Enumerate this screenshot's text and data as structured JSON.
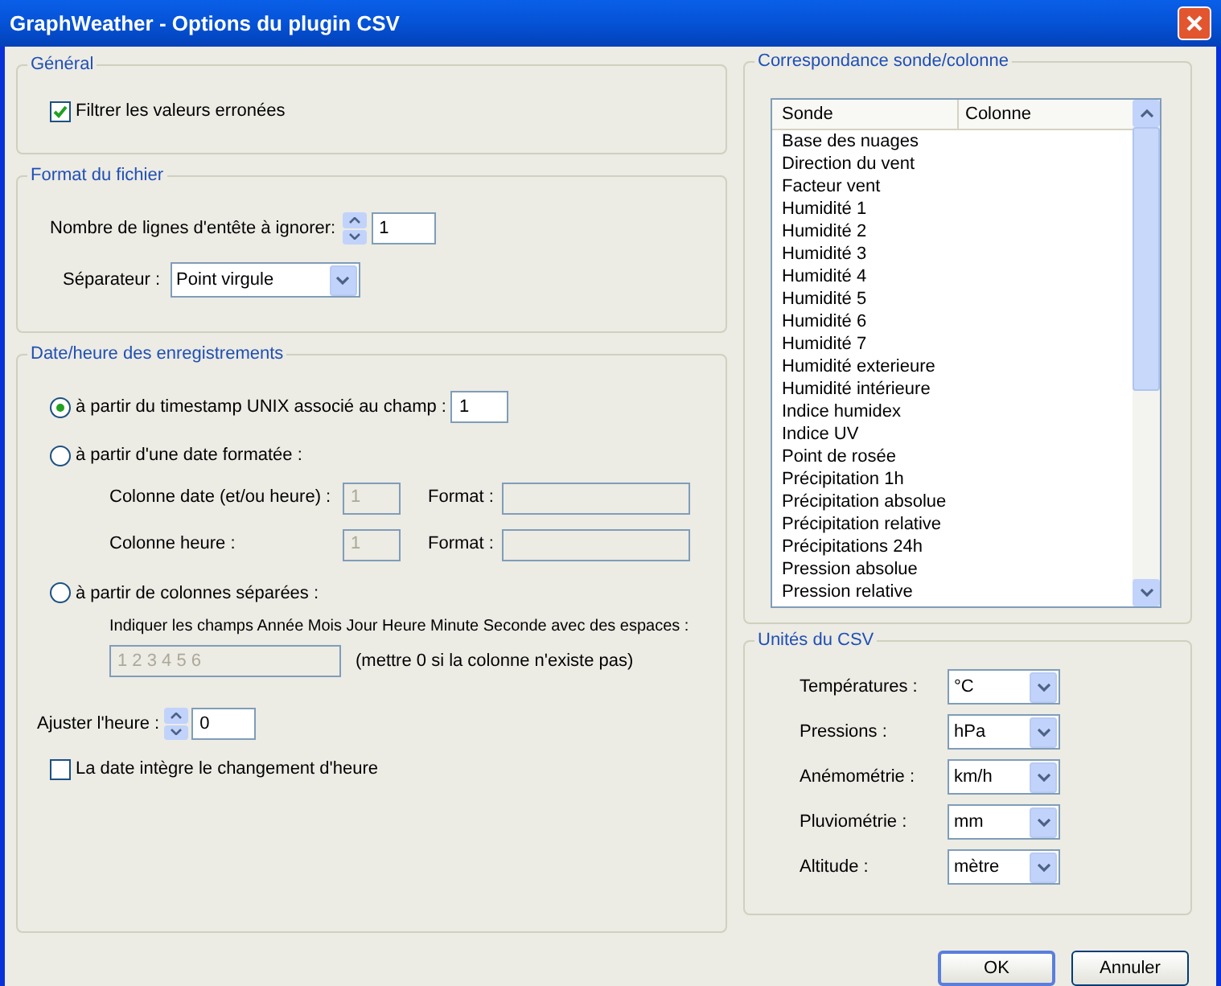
{
  "window": {
    "title": "GraphWeather - Options du plugin CSV"
  },
  "general": {
    "title": "Général",
    "filter_checkbox": {
      "label": "Filtrer les valeurs erronées",
      "checked": true
    }
  },
  "file_format": {
    "title": "Format du fichier",
    "header_lines": {
      "label": "Nombre de lignes d'entête à ignorer:",
      "value": "1"
    },
    "separator": {
      "label": "Séparateur :",
      "value": "Point virgule"
    }
  },
  "datetime": {
    "title": "Date/heure des enregistrements",
    "options": [
      {
        "label": "à partir du timestamp UNIX associé au champ :",
        "selected": true
      },
      {
        "label": "à partir d'une date formatée :",
        "selected": false
      },
      {
        "label": "à partir de colonnes séparées :",
        "selected": false
      }
    ],
    "unix_field": {
      "value": "1",
      "disabled": false
    },
    "formatted_rows": [
      {
        "label": "Colonne date (et/ou heure) :",
        "column": {
          "value": "1",
          "disabled": true
        },
        "format_label": "Format :",
        "format": {
          "disabled": true
        }
      },
      {
        "label": "Colonne heure :",
        "column": {
          "value": "1",
          "disabled": true
        },
        "format_label": "Format :",
        "format": {
          "disabled": true
        }
      }
    ],
    "separate": {
      "hint": "Indiquer les champs Année Mois Jour Heure Minute Seconde avec des espaces :",
      "field": {
        "value": "1 2 3 4 5 6",
        "disabled": true
      },
      "note": "(mettre 0 si la colonne n'existe pas)"
    },
    "adjust_time": {
      "label": "Ajuster l'heure :",
      "value": "0"
    },
    "dst_checkbox": {
      "label": "La date intègre le changement d'heure",
      "checked": false
    }
  },
  "mapping": {
    "title": "Correspondance sonde/colonne",
    "columns": [
      "Sonde",
      "Colonne"
    ],
    "rows": [
      "Base des nuages",
      "Direction du vent",
      "Facteur vent",
      "Humidité 1",
      "Humidité 2",
      "Humidité 3",
      "Humidité 4",
      "Humidité 5",
      "Humidité 6",
      "Humidité 7",
      "Humidité exterieure",
      "Humidité intérieure",
      "Indice humidex",
      "Indice UV",
      "Point de rosée",
      "Précipitation 1h",
      "Précipitation absolue",
      "Précipitation relative",
      "Précipitations 24h",
      "Pression absolue",
      "Pression relative"
    ]
  },
  "units": {
    "title": "Unités du CSV",
    "items": [
      {
        "label": "Températures :",
        "value": "°C"
      },
      {
        "label": "Pressions :",
        "value": "hPa"
      },
      {
        "label": "Anémométrie :",
        "value": "km/h"
      },
      {
        "label": "Pluviométrie :",
        "value": "mm"
      },
      {
        "label": "Altitude :",
        "value": "mètre"
      }
    ]
  },
  "buttons": [
    {
      "label": "OK",
      "default": true
    },
    {
      "label": "Annuler",
      "default": false
    }
  ]
}
